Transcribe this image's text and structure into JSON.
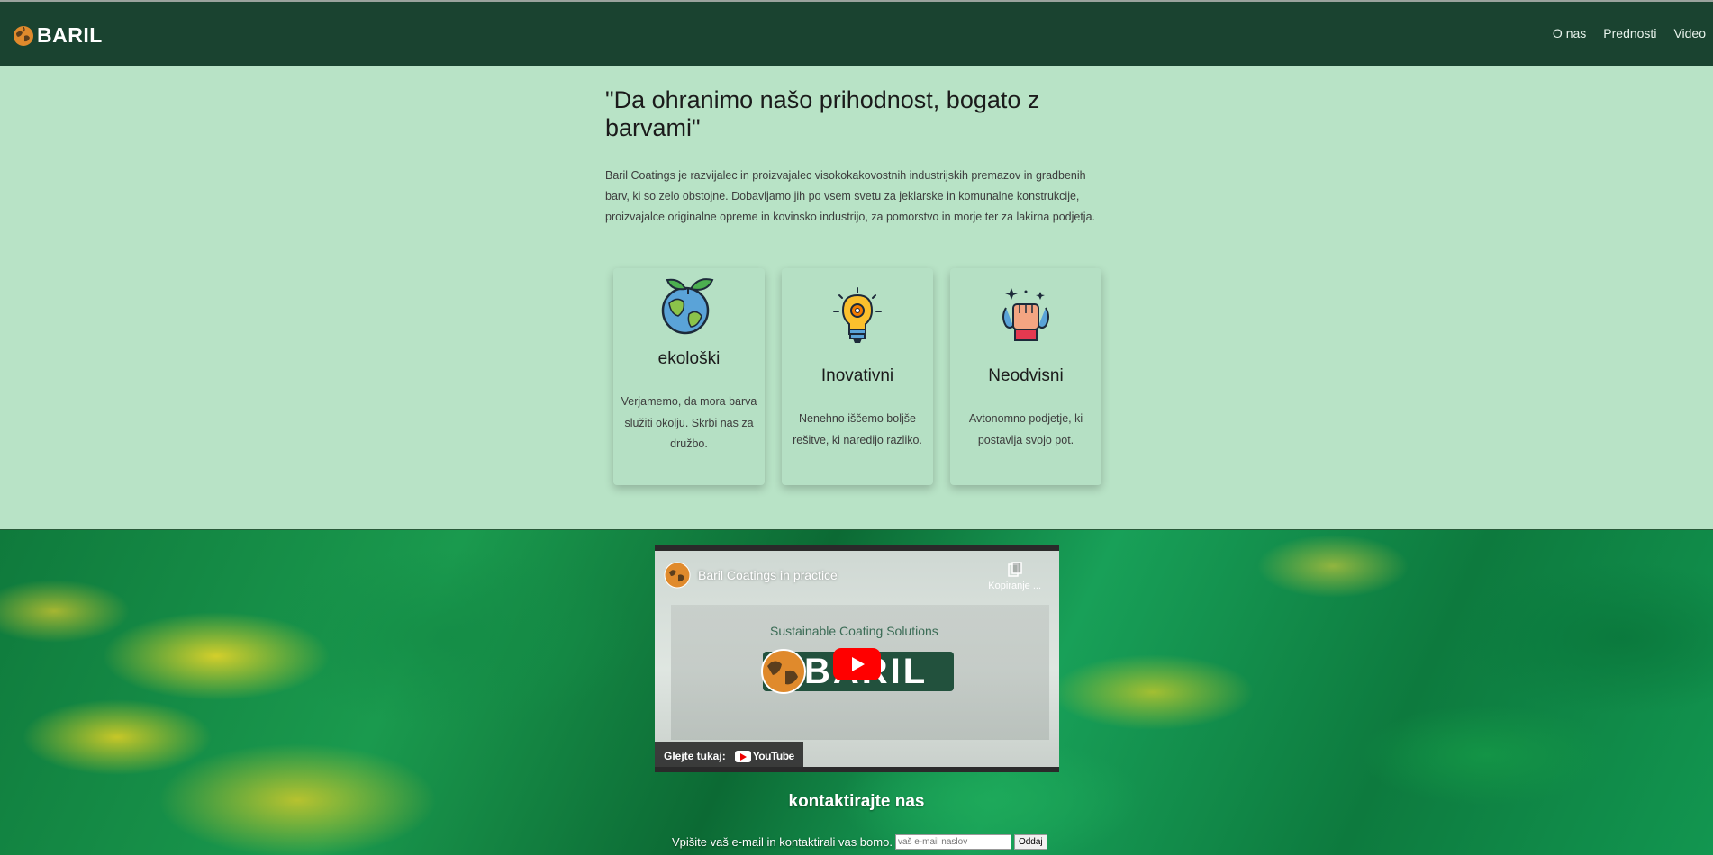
{
  "brand": {
    "name": "BARIL"
  },
  "nav": {
    "items": [
      "O nas",
      "Prednosti",
      "Video"
    ]
  },
  "hero": {
    "heading": "\"Da ohranimo našo prihodnost, bogato z barvami\"",
    "text": "Baril Coatings je razvijalec in proizvajalec visokokakovostnih industrijskih premazov in gradbenih barv, ki so zelo obstojne. Dobavljamo jih po vsem svetu za jeklarske in komunalne konstrukcije, proizvajalce originalne opreme in kovinsko industrijo, za pomorstvo in morje ter za lakirna podjetja."
  },
  "cards": [
    {
      "icon": "eco-globe-icon",
      "title": "ekološki",
      "text": "Verjamemo, da mora barva služiti okolju. Skrbi nas za družbo."
    },
    {
      "icon": "lightbulb-gear-icon",
      "title": "Inovativni",
      "text": "Nenehno iščemo boljše rešitve, ki naredijo razliko."
    },
    {
      "icon": "raised-fist-icon",
      "title": "Neodvisni",
      "text": "Avtonomno podjetje, ki postavlja svojo pot."
    }
  ],
  "video": {
    "title": "Baril Coatings in practice",
    "copy_label": "Kopiranje ...",
    "tagline": "Sustainable Coating Solutions",
    "logo_text": "BARIL",
    "watch_label": "Glejte tukaj:",
    "youtube_label": "YouTube"
  },
  "contact": {
    "title": "kontaktirajte nas",
    "prompt": "Vpišite vaš e-mail in kontaktirali vas bomo.",
    "placeholder": "vaš e-mail naslov",
    "submit_label": "Oddaj"
  }
}
